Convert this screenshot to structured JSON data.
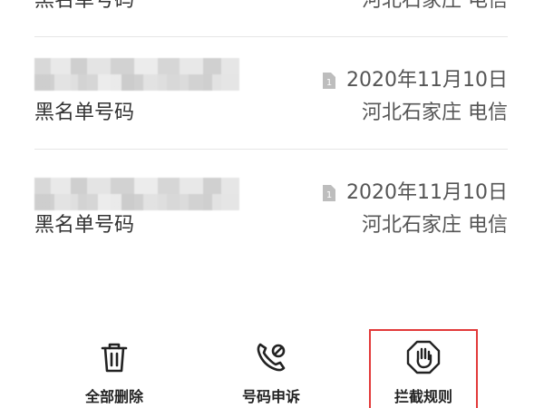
{
  "records": [
    {
      "label": "黑名单号码",
      "location": "河北石家庄 电信"
    },
    {
      "label": "黑名单号码",
      "location": "河北石家庄 电信",
      "date": "2020年11月10日"
    },
    {
      "label": "黑名单号码",
      "location": "河北石家庄 电信",
      "date": "2020年11月10日"
    }
  ],
  "toolbar": {
    "delete_all": "全部删除",
    "appeal": "号码申诉",
    "rules": "拦截规则"
  },
  "colors": {
    "highlight": "#e23a3a",
    "separator": "#e6e6e6"
  },
  "icons": {
    "sim": "sim-card-icon",
    "delete": "trash-icon",
    "appeal": "phone-block-icon",
    "rules": "hand-stop-icon"
  }
}
